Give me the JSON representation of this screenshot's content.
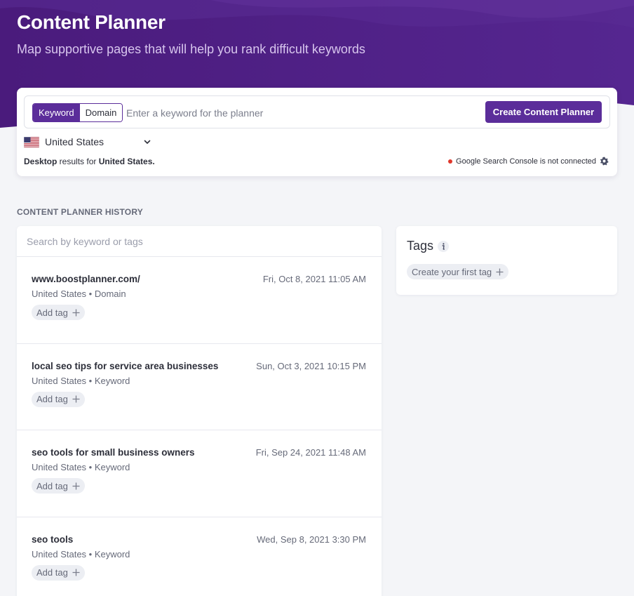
{
  "header": {
    "title": "Content Planner",
    "subtitle": "Map supportive pages that will help you rank difficult keywords"
  },
  "planner": {
    "modes": [
      "Keyword",
      "Domain"
    ],
    "active_mode": "Keyword",
    "input_placeholder": "Enter a keyword for the planner",
    "input_value": "",
    "create_label": "Create Content Planner",
    "country": "United States",
    "results_device": "Desktop",
    "results_middle": " results for ",
    "results_country": "United States.",
    "gsc_status": "Google Search Console is not connected"
  },
  "history": {
    "heading": "CONTENT PLANNER HISTORY",
    "search_placeholder": "Search by keyword or tags",
    "add_tag_label": "Add tag",
    "items": [
      {
        "title": "www.boostplanner.com/",
        "meta": "United States • Domain",
        "date": "Fri, Oct 8, 2021 11:05 AM"
      },
      {
        "title": "local seo tips for service area businesses",
        "meta": "United States • Keyword",
        "date": "Sun, Oct 3, 2021 10:15 PM"
      },
      {
        "title": "seo tools for small business owners",
        "meta": "United States • Keyword",
        "date": "Fri, Sep 24, 2021 11:48 AM"
      },
      {
        "title": "seo tools",
        "meta": "United States • Keyword",
        "date": "Wed, Sep 8, 2021 3:30 PM"
      }
    ]
  },
  "tags": {
    "title": "Tags",
    "create_label": "Create your first tag"
  },
  "colors": {
    "brand": "#5b2d9a",
    "hero": "#4b1d7e",
    "status_error": "#e0382c"
  },
  "icons": [
    "us-flag-icon",
    "chevron-down-icon",
    "gear-icon",
    "plus-icon",
    "info-icon"
  ]
}
